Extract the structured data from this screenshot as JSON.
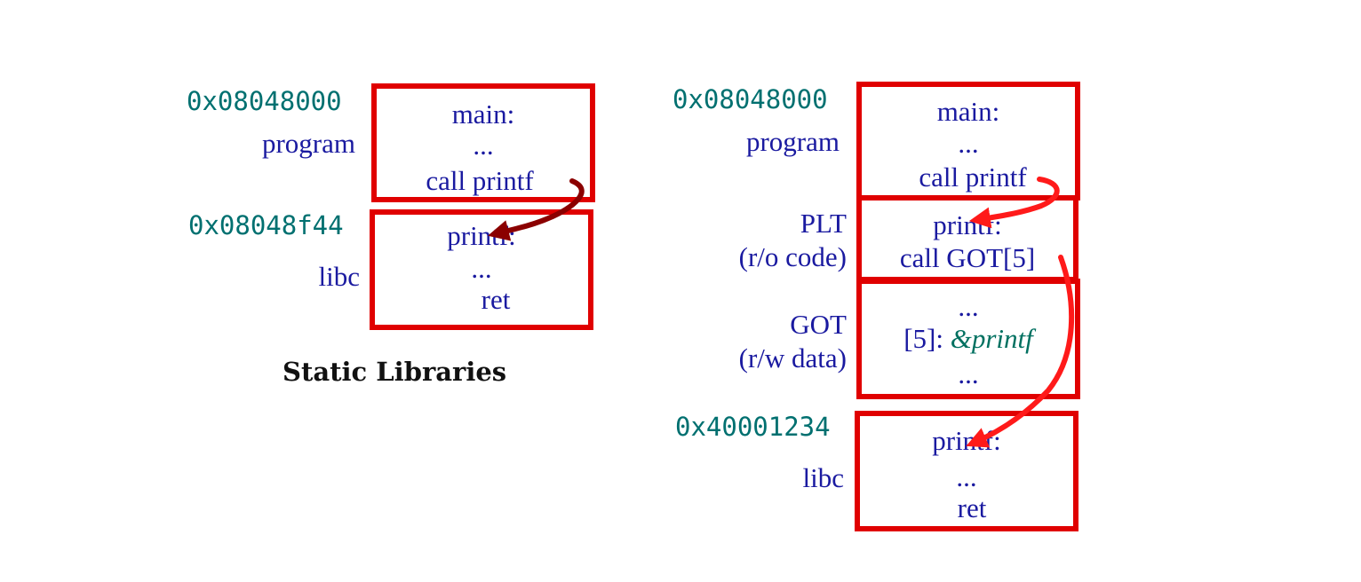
{
  "static": {
    "caption": "Static Libraries",
    "program": {
      "address": "0x08048000",
      "label": "program",
      "lines": [
        "main:",
        "...",
        "call printf"
      ]
    },
    "libc": {
      "address": "0x08048f44",
      "label": "libc",
      "lines": [
        "printf:",
        "...",
        "ret"
      ]
    }
  },
  "dynamic": {
    "program": {
      "address": "0x08048000",
      "label": "program",
      "lines": [
        "main:",
        "...",
        "call printf"
      ]
    },
    "plt": {
      "label": "PLT",
      "sublabel": "(r/o code)",
      "lines": [
        "printf:",
        "call GOT[5]"
      ]
    },
    "got": {
      "label": "GOT",
      "sublabel": "(r/w data)",
      "line_top": "...",
      "entry_prefix": "[5]: ",
      "entry_value": "&printf",
      "line_bottom": "..."
    },
    "libc": {
      "address": "0x40001234",
      "label": "libc",
      "lines": [
        "printf:",
        "...",
        "ret"
      ]
    }
  },
  "colors": {
    "box_border": "#e00000",
    "arrow_static": "#8b0000",
    "arrow_dynamic": "#ff1a1a",
    "address": "#007070",
    "text": "#1a1aa0"
  }
}
